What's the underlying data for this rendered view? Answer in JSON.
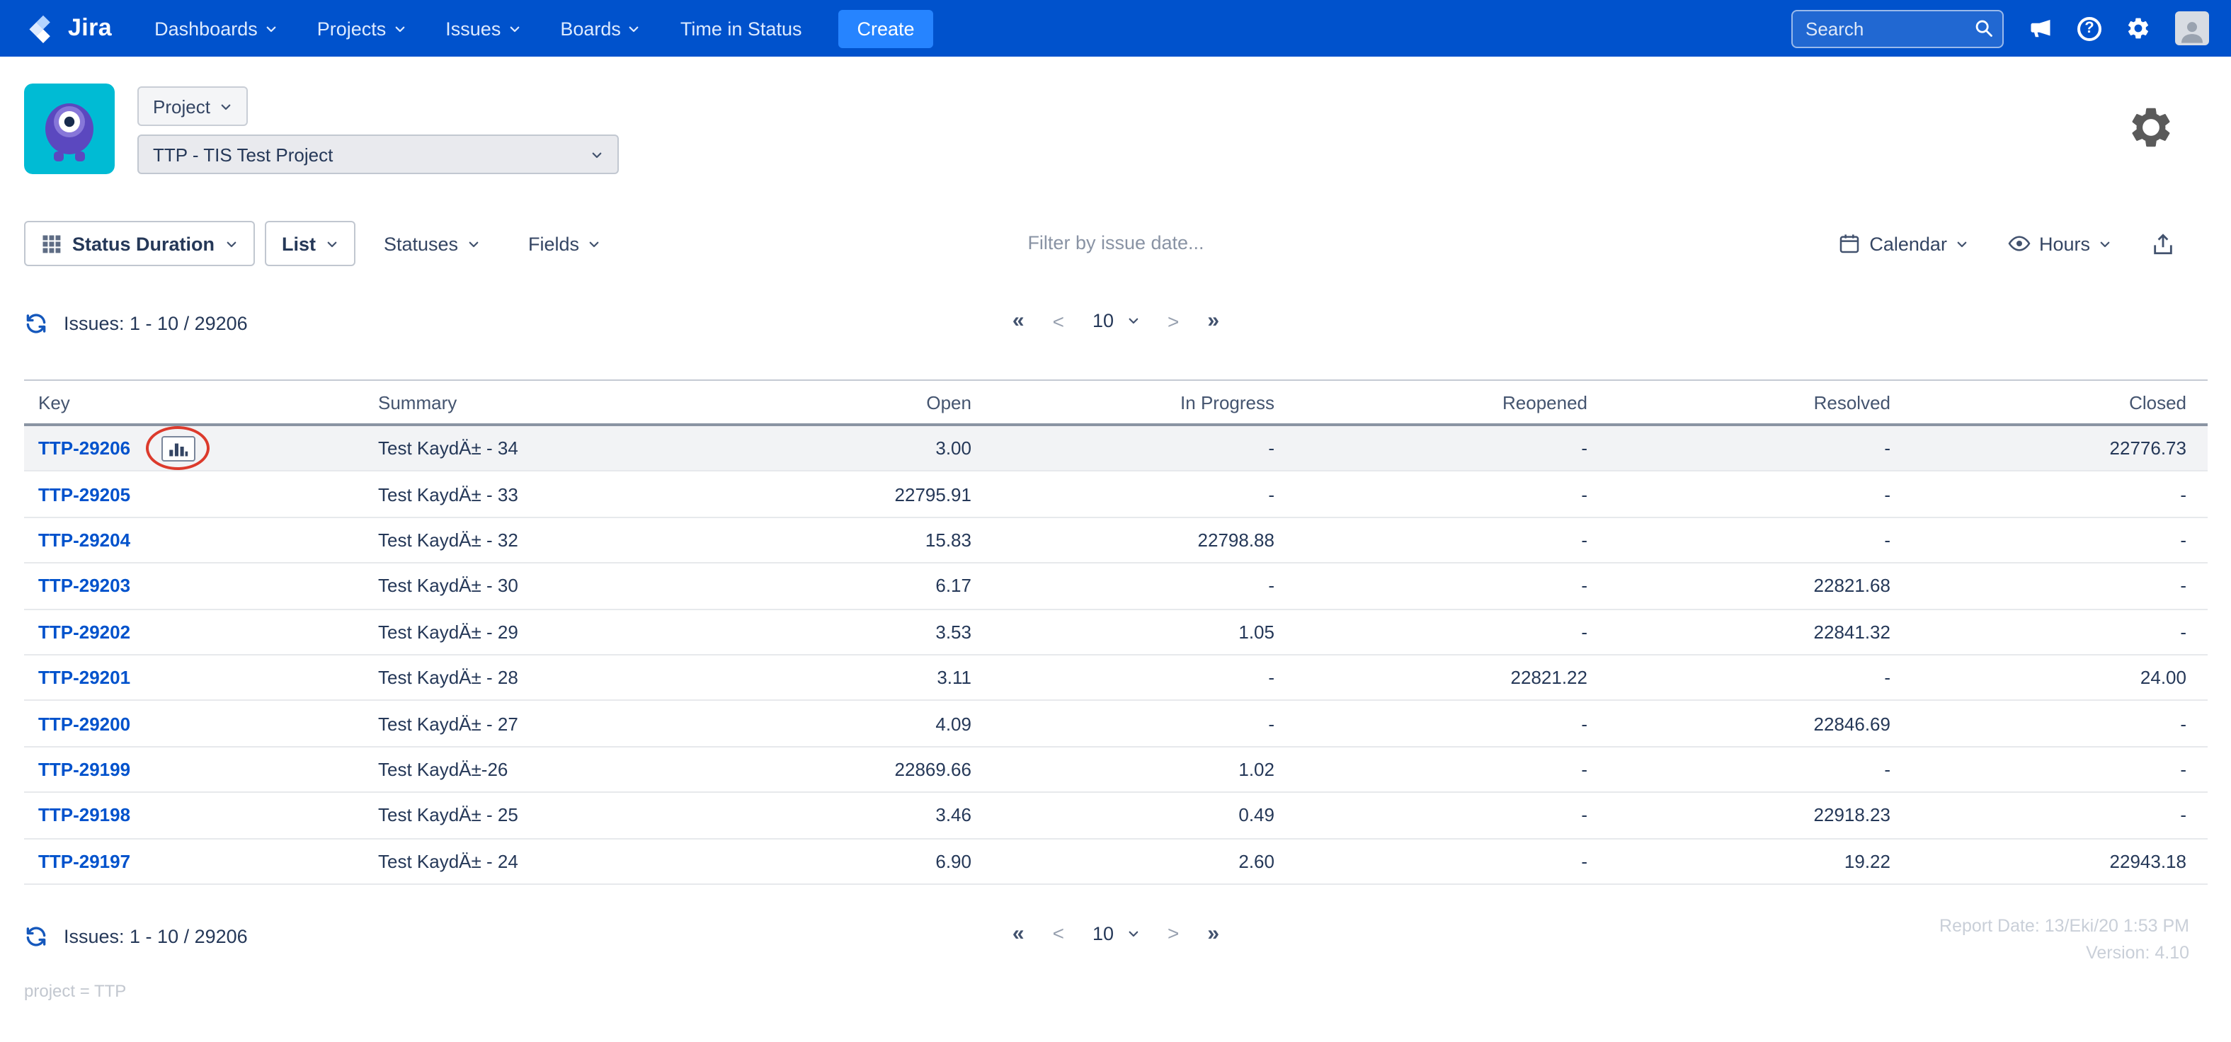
{
  "nav": {
    "brand": "Jira",
    "items": [
      {
        "label": "Dashboards"
      },
      {
        "label": "Projects"
      },
      {
        "label": "Issues"
      },
      {
        "label": "Boards"
      },
      {
        "label": "Time in Status"
      }
    ],
    "create_label": "Create",
    "search_placeholder": "Search"
  },
  "header": {
    "project_button_label": "Project",
    "project_select_value": "TTP - TIS Test Project"
  },
  "toolbar": {
    "report_type_label": "Status Duration",
    "view_label": "List",
    "statuses_label": "Statuses",
    "fields_label": "Fields",
    "filter_placeholder": "Filter by issue date...",
    "calendar_label": "Calendar",
    "hours_label": "Hours"
  },
  "pagination": {
    "issues_summary": "Issues: 1 - 10 / 29206",
    "first": "«",
    "prev": "<",
    "page_size": "10",
    "next": ">",
    "last": "»"
  },
  "table": {
    "columns": [
      "Key",
      "Summary",
      "Open",
      "In Progress",
      "Reopened",
      "Resolved",
      "Closed"
    ],
    "rows": [
      {
        "key": "TTP-29206",
        "summary": "Test KaydÄ± - 34",
        "open": "3.00",
        "in_progress": "-",
        "reopened": "-",
        "resolved": "-",
        "closed": "22776.73",
        "highlighted": true
      },
      {
        "key": "TTP-29205",
        "summary": "Test KaydÄ± - 33",
        "open": "22795.91",
        "in_progress": "-",
        "reopened": "-",
        "resolved": "-",
        "closed": "-"
      },
      {
        "key": "TTP-29204",
        "summary": "Test KaydÄ± - 32",
        "open": "15.83",
        "in_progress": "22798.88",
        "reopened": "-",
        "resolved": "-",
        "closed": "-"
      },
      {
        "key": "TTP-29203",
        "summary": "Test KaydÄ± - 30",
        "open": "6.17",
        "in_progress": "-",
        "reopened": "-",
        "resolved": "22821.68",
        "closed": "-"
      },
      {
        "key": "TTP-29202",
        "summary": "Test KaydÄ± - 29",
        "open": "3.53",
        "in_progress": "1.05",
        "reopened": "-",
        "resolved": "22841.32",
        "closed": "-"
      },
      {
        "key": "TTP-29201",
        "summary": "Test KaydÄ± - 28",
        "open": "3.11",
        "in_progress": "-",
        "reopened": "22821.22",
        "resolved": "-",
        "closed": "24.00"
      },
      {
        "key": "TTP-29200",
        "summary": "Test KaydÄ± - 27",
        "open": "4.09",
        "in_progress": "-",
        "reopened": "-",
        "resolved": "22846.69",
        "closed": "-"
      },
      {
        "key": "TTP-29199",
        "summary": "Test KaydÄ±-26",
        "open": "22869.66",
        "in_progress": "1.02",
        "reopened": "-",
        "resolved": "-",
        "closed": "-"
      },
      {
        "key": "TTP-29198",
        "summary": "Test KaydÄ± - 25",
        "open": "3.46",
        "in_progress": "0.49",
        "reopened": "-",
        "resolved": "22918.23",
        "closed": "-"
      },
      {
        "key": "TTP-29197",
        "summary": "Test KaydÄ± - 24",
        "open": "6.90",
        "in_progress": "2.60",
        "reopened": "-",
        "resolved": "19.22",
        "closed": "22943.18"
      }
    ]
  },
  "footer": {
    "report_date": "Report Date: 13/Eki/20 1:53 PM",
    "version": "Version: 4.10",
    "query": "project = TTP"
  },
  "colors": {
    "nav_blue": "#0052CC",
    "create_blue": "#2684FF",
    "link_blue": "#0052CC",
    "annotation_red": "#DC3A2C"
  }
}
